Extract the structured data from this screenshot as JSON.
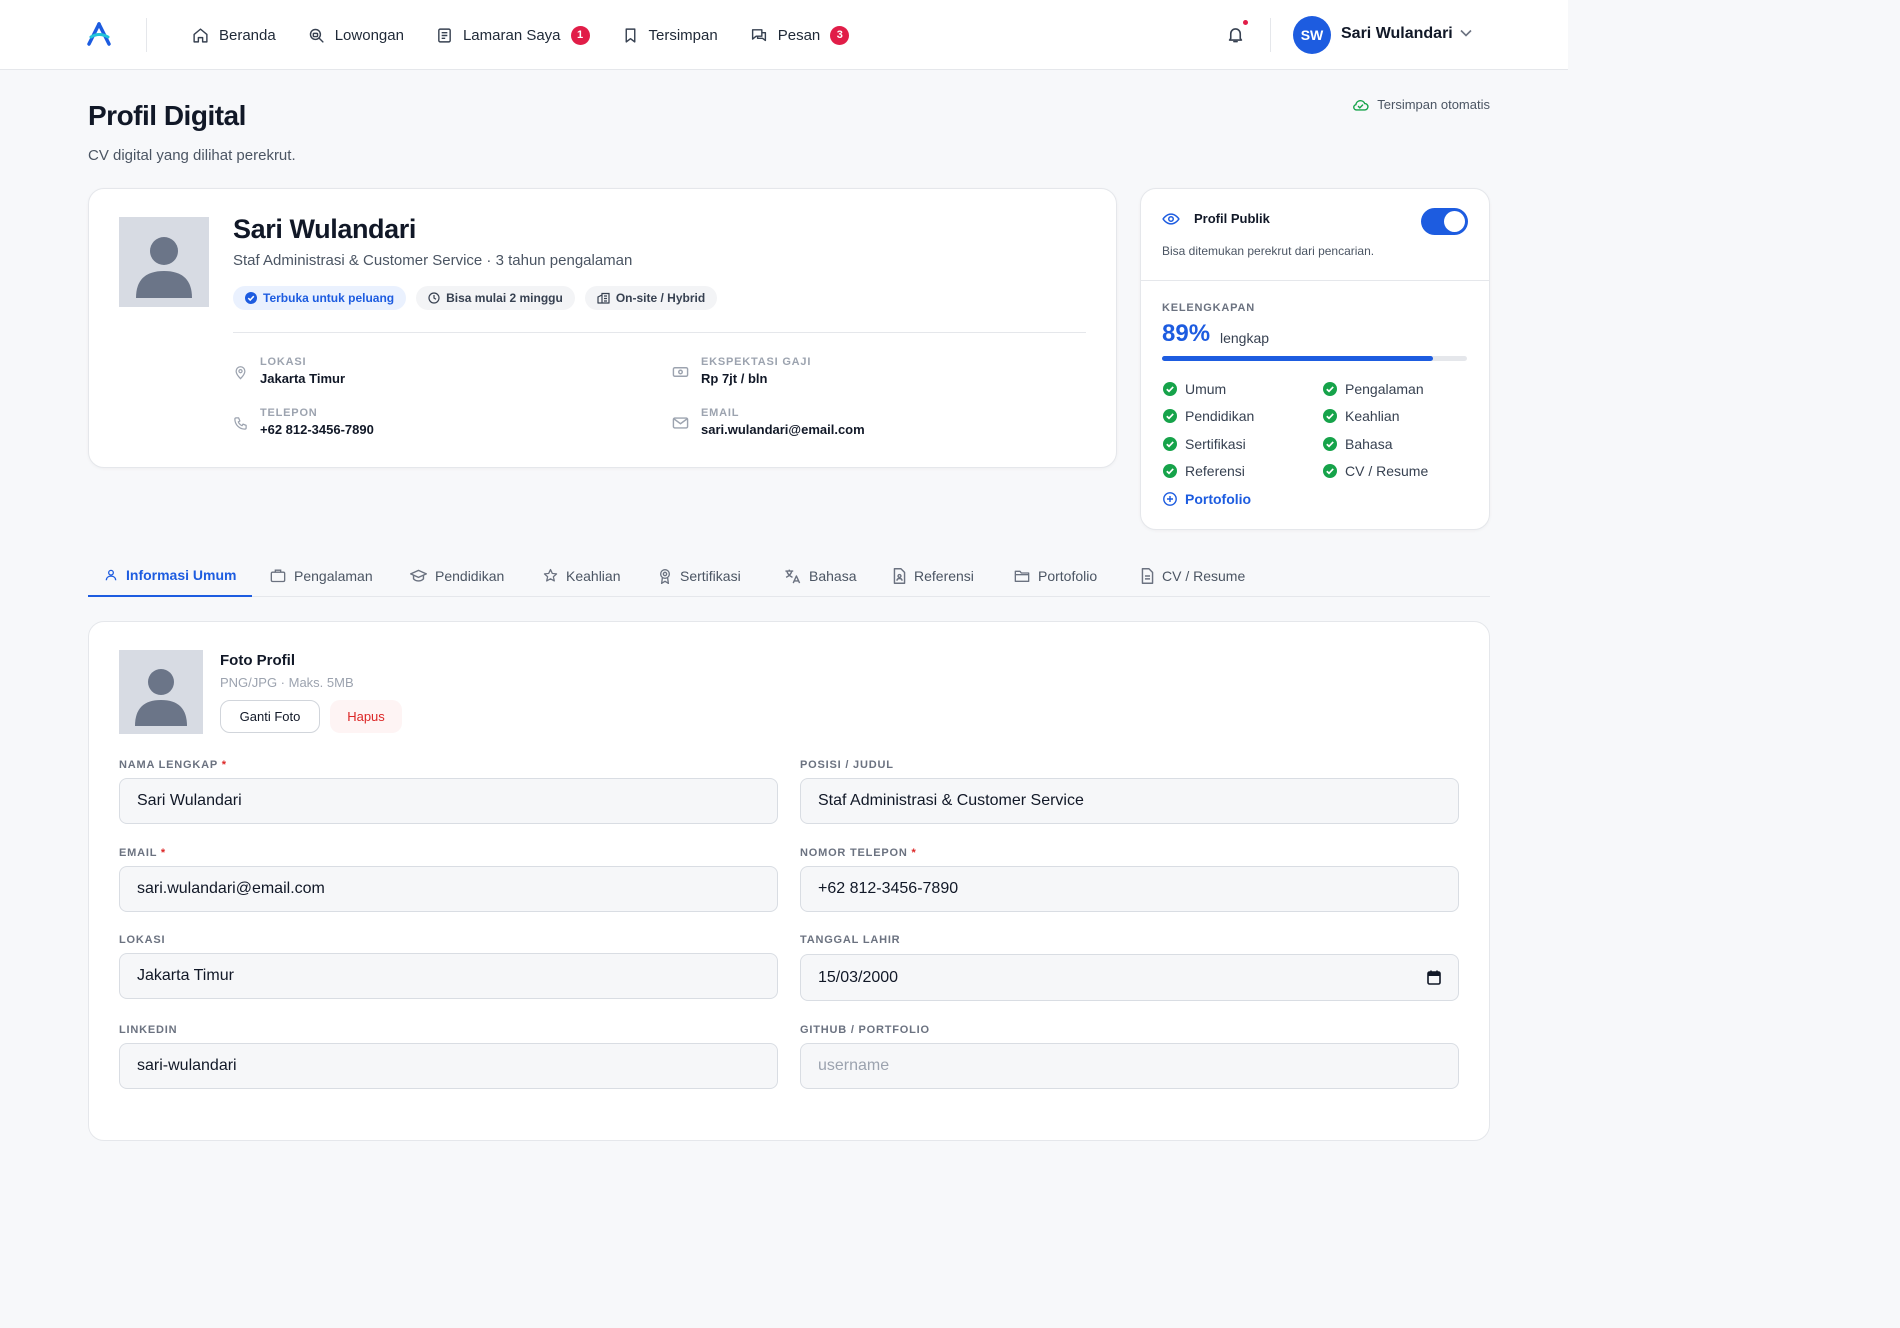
{
  "nav": {
    "items": [
      {
        "label": "Beranda",
        "icon": "home-icon"
      },
      {
        "label": "Lowongan",
        "icon": "search-job-icon"
      },
      {
        "label": "Lamaran Saya",
        "icon": "list-icon",
        "badge": "1"
      },
      {
        "label": "Tersimpan",
        "icon": "bookmark-icon"
      },
      {
        "label": "Pesan",
        "icon": "chat-icon",
        "badge": "3"
      }
    ]
  },
  "user": {
    "initials": "SW",
    "name": "Sari Wulandari"
  },
  "page": {
    "title": "Profil Digital",
    "subtitle": "CV digital yang dilihat perekrut.",
    "autosave": "Tersimpan otomatis"
  },
  "profile": {
    "name": "Sari Wulandari",
    "headline": "Staf Administrasi & Customer Service · 3 tahun pengalaman",
    "chips": [
      "Terbuka untuk peluang",
      "Bisa mulai 2 minggu",
      "On-site / Hybrid"
    ],
    "location_label": "LOKASI",
    "location": "Jakarta Timur",
    "salary_label": "EKSPEKTASI GAJI",
    "salary": "Rp 7jt / bln",
    "phone_label": "TELEPON",
    "phone": "+62 812-3456-7890",
    "email_label": "EMAIL",
    "email": "sari.wulandari@email.com"
  },
  "public_profile": {
    "title": "Profil Publik",
    "description": "Bisa ditemukan perekrut dari pencarian.",
    "enabled": true
  },
  "completeness": {
    "label": "KELENGKAPAN",
    "percent_text": "89%",
    "percent": 89,
    "suffix": "lengkap",
    "items": [
      {
        "label": "Umum",
        "done": true
      },
      {
        "label": "Pengalaman",
        "done": true
      },
      {
        "label": "Pendidikan",
        "done": true
      },
      {
        "label": "Keahlian",
        "done": true
      },
      {
        "label": "Sertifikasi",
        "done": true
      },
      {
        "label": "Bahasa",
        "done": true
      },
      {
        "label": "Referensi",
        "done": true
      },
      {
        "label": "CV / Resume",
        "done": true
      },
      {
        "label": "Portofolio",
        "done": false
      }
    ]
  },
  "tabs": [
    {
      "label": "Informasi Umum",
      "active": true
    },
    {
      "label": "Pengalaman"
    },
    {
      "label": "Pendidikan"
    },
    {
      "label": "Keahlian"
    },
    {
      "label": "Sertifikasi"
    },
    {
      "label": "Bahasa"
    },
    {
      "label": "Referensi"
    },
    {
      "label": "Portofolio"
    },
    {
      "label": "CV / Resume"
    }
  ],
  "photo": {
    "title": "Foto Profil",
    "hint": "PNG/JPG · Maks. 5MB",
    "change_label": "Ganti Foto",
    "delete_label": "Hapus"
  },
  "form": {
    "full_name": {
      "label": "NAMA LENGKAP",
      "required": "*",
      "value": "Sari Wulandari"
    },
    "position": {
      "label": "POSISI / JUDUL",
      "value": "Staf Administrasi & Customer Service"
    },
    "email": {
      "label": "EMAIL",
      "required": "*",
      "value": "sari.wulandari@email.com"
    },
    "phone": {
      "label": "NOMOR TELEPON",
      "required": "*",
      "value": "+62 812-3456-7890"
    },
    "location": {
      "label": "LOKASI",
      "value": "Jakarta Timur"
    },
    "birthdate": {
      "label": "TANGGAL LAHIR",
      "value": "15/03/2000"
    },
    "linkedin": {
      "label": "LINKEDIN",
      "value": "sari-wulandari"
    },
    "github": {
      "label": "GITHUB / PORTFOLIO",
      "value": "",
      "placeholder": "username"
    }
  },
  "colors": {
    "accent": "#1d5ce0",
    "success": "#16a34a",
    "danger": "#dc2626",
    "badge": "#e11d48"
  }
}
